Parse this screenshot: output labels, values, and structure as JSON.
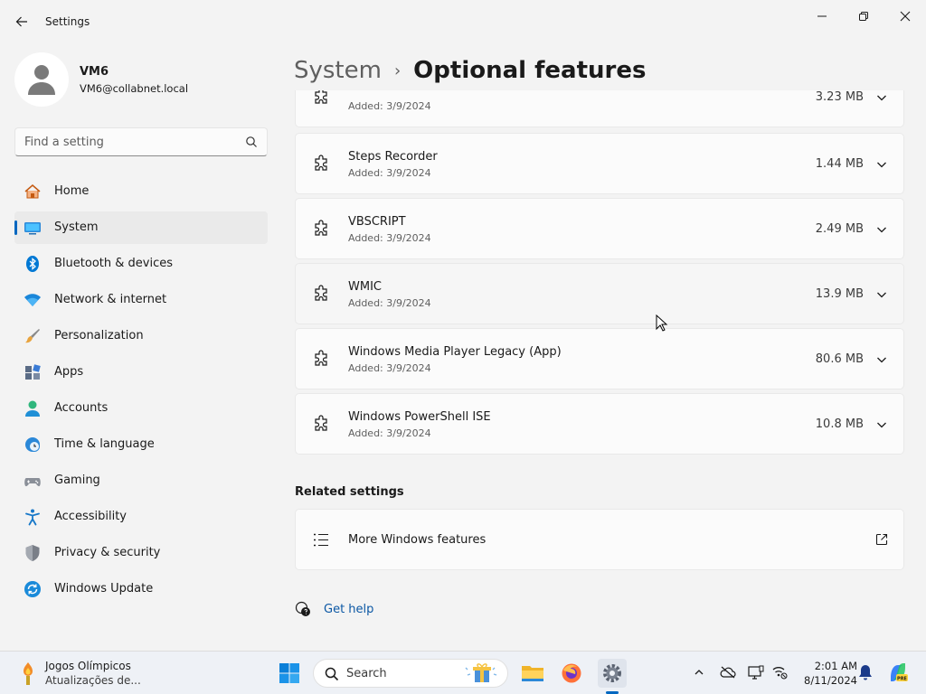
{
  "window": {
    "title": "Settings"
  },
  "profile": {
    "name": "VM6",
    "email": "VM6@collabnet.local"
  },
  "search": {
    "placeholder": "Find a setting"
  },
  "nav": [
    {
      "label": "Home",
      "icon": "home-icon"
    },
    {
      "label": "System",
      "icon": "system-icon",
      "selected": true
    },
    {
      "label": "Bluetooth & devices",
      "icon": "bluetooth-icon"
    },
    {
      "label": "Network & internet",
      "icon": "wifi-icon"
    },
    {
      "label": "Personalization",
      "icon": "brush-icon"
    },
    {
      "label": "Apps",
      "icon": "apps-icon"
    },
    {
      "label": "Accounts",
      "icon": "accounts-icon"
    },
    {
      "label": "Time & language",
      "icon": "clock-globe-icon"
    },
    {
      "label": "Gaming",
      "icon": "gamepad-icon"
    },
    {
      "label": "Accessibility",
      "icon": "accessibility-icon"
    },
    {
      "label": "Privacy & security",
      "icon": "shield-icon"
    },
    {
      "label": "Windows Update",
      "icon": "update-icon"
    }
  ],
  "breadcrumb": {
    "parent": "System",
    "separator": "›",
    "current": "Optional features"
  },
  "features": [
    {
      "name": "",
      "added": "Added: 3/9/2024",
      "size": "3.23 MB"
    },
    {
      "name": "Steps Recorder",
      "added": "Added: 3/9/2024",
      "size": "1.44 MB"
    },
    {
      "name": "VBSCRIPT",
      "added": "Added: 3/9/2024",
      "size": "2.49 MB"
    },
    {
      "name": "WMIC",
      "added": "Added: 3/9/2024",
      "size": "13.9 MB"
    },
    {
      "name": "Windows Media Player Legacy (App)",
      "added": "Added: 3/9/2024",
      "size": "80.6 MB"
    },
    {
      "name": "Windows PowerShell ISE",
      "added": "Added: 3/9/2024",
      "size": "10.8 MB"
    }
  ],
  "related": {
    "heading": "Related settings",
    "items": [
      {
        "label": "More Windows features"
      }
    ]
  },
  "help": {
    "label": "Get help"
  },
  "taskbar": {
    "widget_title": "Jogos Olímpicos",
    "widget_subtitle": "Atualizações de...",
    "search_label": "Search",
    "time": "2:01 AM",
    "date": "8/11/2024"
  },
  "colors": {
    "accent": "#0067c0",
    "link": "#0b57a4"
  }
}
